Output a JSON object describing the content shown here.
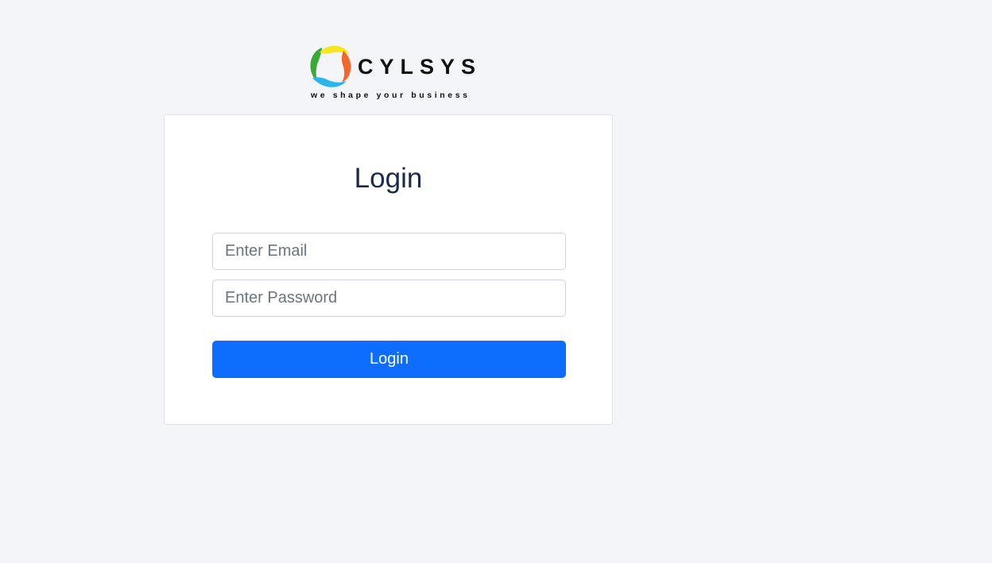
{
  "brand": {
    "name": "CYLSYS",
    "tagline": "we shape your business",
    "colors": {
      "green": "#3aa935",
      "yellow": "#f6e71d",
      "orange": "#f2672c",
      "blue": "#29b6e9"
    }
  },
  "login_form": {
    "title": "Login",
    "email_placeholder": "Enter Email",
    "email_value": "",
    "password_placeholder": "Enter Password",
    "password_value": "",
    "submit_label": "Login",
    "accent_color": "#0d6efd"
  }
}
